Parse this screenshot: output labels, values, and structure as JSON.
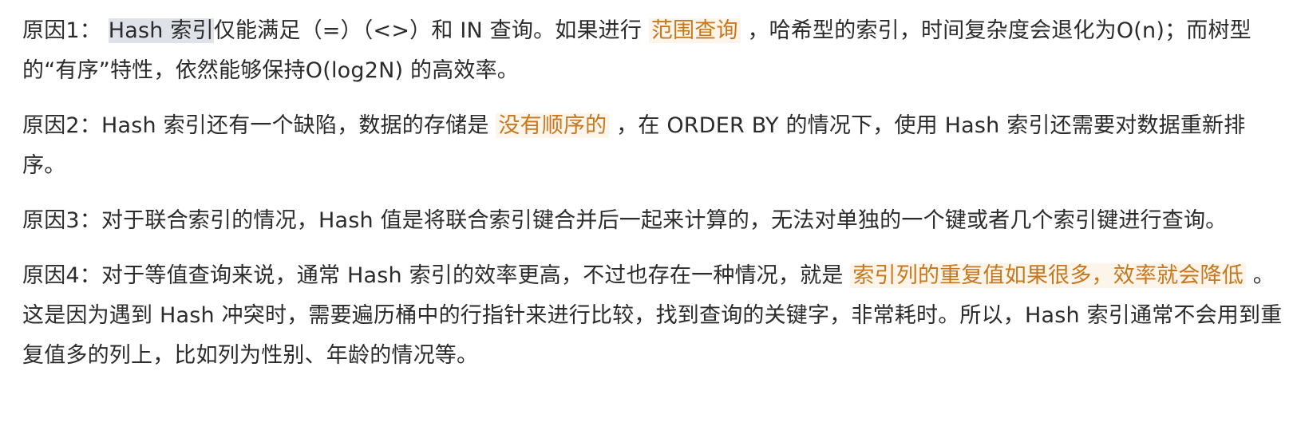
{
  "paragraphs": [
    {
      "id": "reason-1",
      "segments": [
        {
          "text": "原因1： ",
          "highlight": false
        },
        {
          "text": "Hash 索引",
          "highlight": false,
          "selected": true
        },
        {
          "text": "仅能满足（=）（<>）和 IN 查询。如果进行 ",
          "highlight": false
        },
        {
          "text": "范围查询",
          "highlight": true
        },
        {
          "text": " ，哈希型的索引，时间复杂度会退化为O(n)；而树型的“有序”特性，依然能够保持O(log2N) 的高效率。",
          "highlight": false
        }
      ]
    },
    {
      "id": "reason-2",
      "segments": [
        {
          "text": "原因2：Hash 索引还有一个缺陷，数据的存储是 ",
          "highlight": false
        },
        {
          "text": "没有顺序的",
          "highlight": true
        },
        {
          "text": " ，在 ORDER BY 的情况下，使用 Hash 索引还需要对数据重新排序。",
          "highlight": false
        }
      ]
    },
    {
      "id": "reason-3",
      "segments": [
        {
          "text": "原因3：对于联合索引的情况，Hash 值是将联合索引键合并后一起来计算的，无法对单独的一个键或者几个索引键进行查询。",
          "highlight": false
        }
      ]
    },
    {
      "id": "reason-4",
      "segments": [
        {
          "text": "原因4：对于等值查询来说，通常 Hash 索引的效率更高，不过也存在一种情况，就是 ",
          "highlight": false
        },
        {
          "text": "索引列的重复值如果很多，效率就会降低",
          "highlight": true
        },
        {
          "text": " 。这是因为遇到 Hash 冲突时，需要遍历桶中的行指针来进行比较，找到查询的关键字，非常耗时。所以，Hash 索引通常不会用到重复值多的列上，比如列为性别、年龄的情况等。",
          "highlight": false
        }
      ]
    }
  ],
  "colors": {
    "text": "#2b2b2b",
    "highlight_text": "#c7781f",
    "highlight_bg": "#fdf5ea",
    "selection_bg": "#dfe2e8"
  }
}
